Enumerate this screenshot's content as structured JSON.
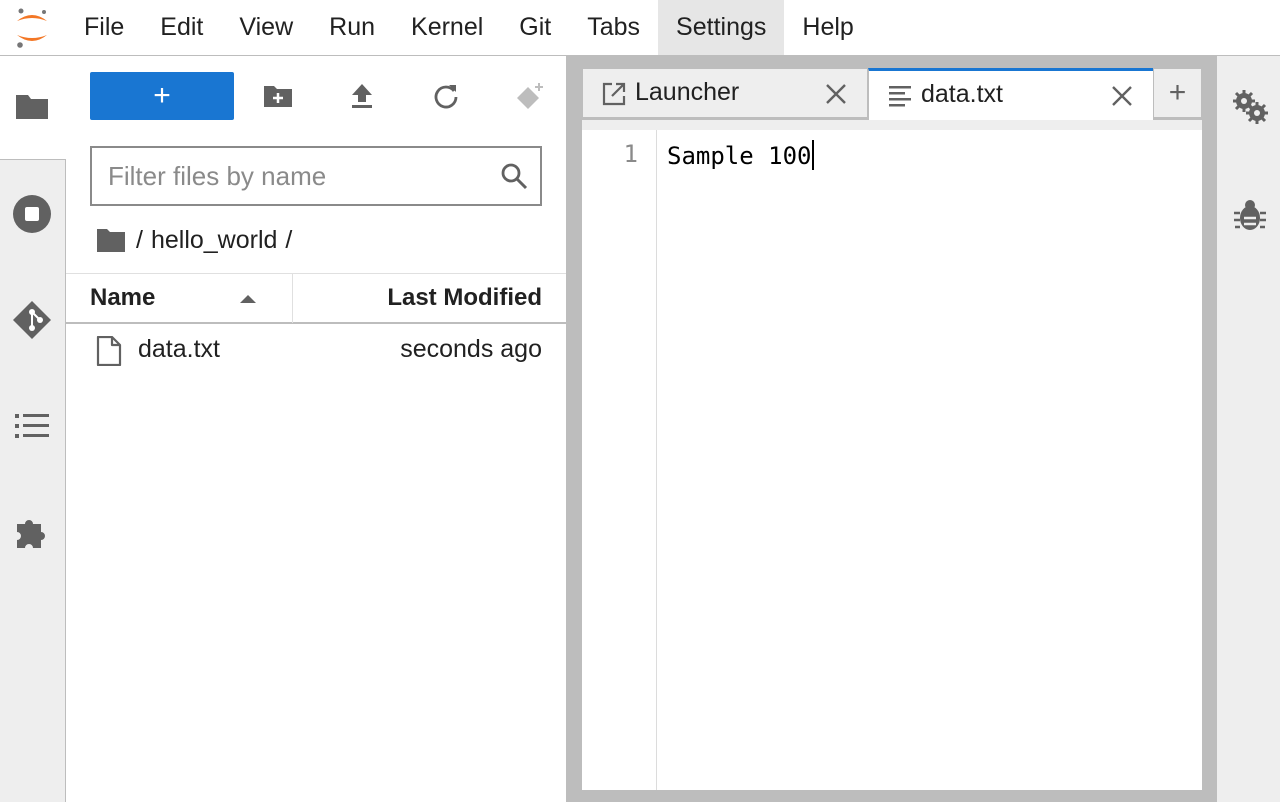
{
  "menubar": {
    "items": [
      "File",
      "Edit",
      "View",
      "Run",
      "Kernel",
      "Git",
      "Tabs",
      "Settings",
      "Help"
    ],
    "active": "Settings"
  },
  "leftbar": {
    "icons": [
      "folder-icon",
      "running-icon",
      "git-icon",
      "table-of-contents-icon",
      "extension-icon"
    ]
  },
  "filebrowser": {
    "new_button_label": "+",
    "toolbar_icons": [
      "new-folder-icon",
      "upload-icon",
      "refresh-icon",
      "git-clone-icon"
    ],
    "filter_placeholder": "Filter files by name",
    "breadcrumb": [
      "/",
      "hello_world",
      "/"
    ],
    "columns": {
      "name": "Name",
      "modified": "Last Modified"
    },
    "files": [
      {
        "name": "data.txt",
        "modified": "seconds ago"
      }
    ]
  },
  "tabs": [
    {
      "label": "Launcher",
      "icon": "launcher-icon",
      "active": false
    },
    {
      "label": "data.txt",
      "icon": "text-file-icon",
      "active": true
    }
  ],
  "add_tab_label": "+",
  "editor": {
    "lines": [
      {
        "number": "1",
        "text": "Sample 100"
      }
    ]
  },
  "rightbar": {
    "icons": [
      "property-inspector-icon",
      "debugger-icon"
    ]
  },
  "colors": {
    "accent": "#1976d2",
    "logo_orange": "#f37726",
    "icon_gray": "#616161"
  }
}
